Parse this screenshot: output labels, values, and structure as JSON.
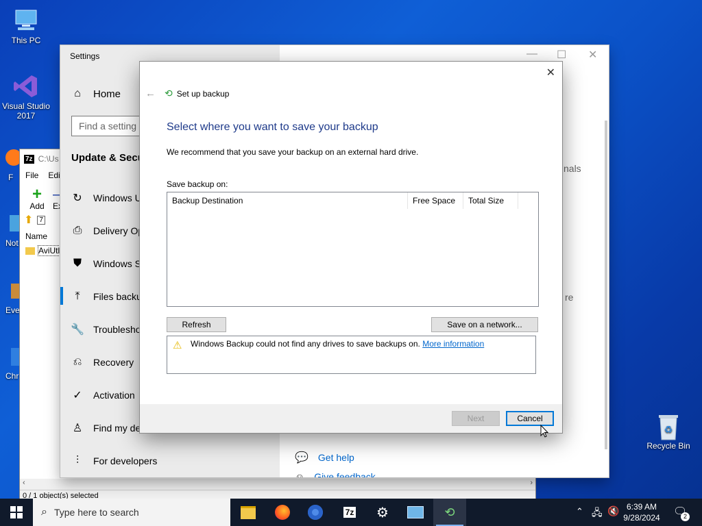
{
  "desktop": {
    "icons": [
      {
        "label": "This PC"
      },
      {
        "label": "Visual Studio 2017"
      },
      {
        "label": "F"
      },
      {
        "label": "Not"
      },
      {
        "label": "Eve"
      },
      {
        "label": "Chr"
      },
      {
        "label": "Recycle Bin"
      }
    ]
  },
  "zip_window": {
    "title": "C:\\Us",
    "app_badge": "7z",
    "menu": [
      "File",
      "Edit"
    ],
    "toolbar": {
      "add_label": "Add",
      "extract_label": "Ex"
    },
    "column_name": "Name",
    "file_item": "AviUtl",
    "status": "0 / 1 object(s) selected"
  },
  "settings": {
    "title": "Settings",
    "home_label": "Home",
    "search_placeholder": "Find a setting",
    "section_title": "Update & Secur",
    "nav": [
      {
        "label": "Windows U"
      },
      {
        "label": "Delivery Op"
      },
      {
        "label": "Windows S"
      },
      {
        "label": "Files backup"
      },
      {
        "label": "Troublesho"
      },
      {
        "label": "Recovery"
      },
      {
        "label": "Activation"
      },
      {
        "label": "Find my de"
      },
      {
        "label": "For developers"
      }
    ],
    "right_fragments": {
      "a": "nals",
      "b": "re"
    },
    "get_help": "Get help",
    "give_feedback": "Give feedback"
  },
  "dialog": {
    "header_title": "Set up backup",
    "heading": "Select where you want to save your backup",
    "recommend": "We recommend that you save your backup on an external hard drive.",
    "save_on_label": "Save backup on:",
    "columns": [
      "Backup Destination",
      "Free Space",
      "Total Size"
    ],
    "refresh_label": "Refresh",
    "network_label": "Save on a network...",
    "warning_text": "Windows Backup could not find any drives to save backups on.",
    "more_info": "More information",
    "next_label": "Next",
    "cancel_label": "Cancel"
  },
  "taskbar": {
    "search_placeholder": "Type here to search",
    "time": "6:39 AM",
    "date": "9/28/2024",
    "notif_count": "2",
    "zip_badge": "7z"
  },
  "colors": {
    "heading_blue": "#1e3a8a",
    "link_blue": "#0066cc",
    "accent_blue": "#0078d7"
  }
}
